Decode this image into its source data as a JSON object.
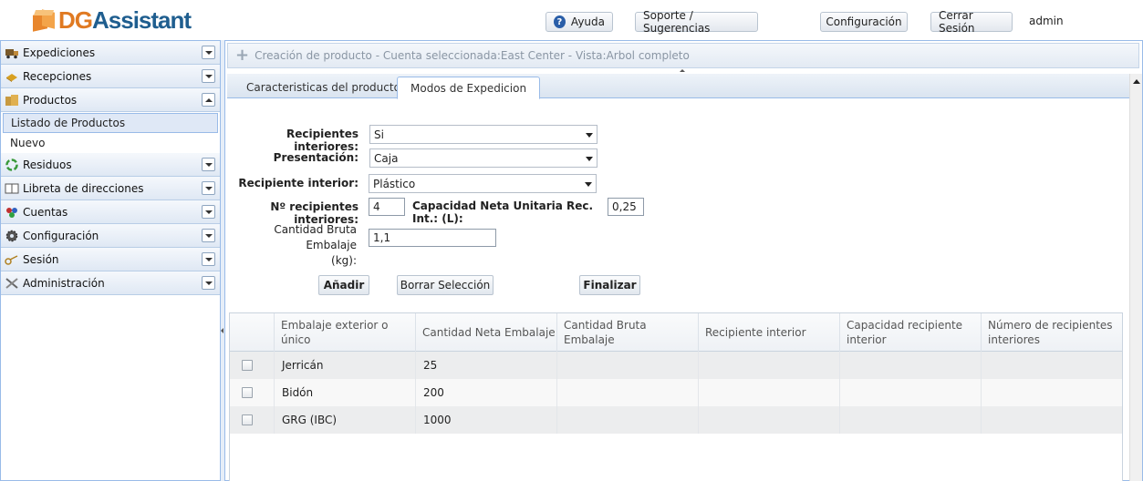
{
  "app": {
    "logo_part1": "DG",
    "logo_part2": "Assistant"
  },
  "header": {
    "help": "Ayuda",
    "support": "Soporte / Sugerencias",
    "config": "Configuración",
    "logout": "Cerrar Sesión",
    "user": "admin"
  },
  "sidebar": {
    "items": [
      {
        "label": "Expediciones",
        "icon": "truck-icon",
        "state": "collapsed"
      },
      {
        "label": "Recepciones",
        "icon": "box-icon",
        "state": "collapsed"
      },
      {
        "label": "Productos",
        "icon": "products-icon",
        "state": "expanded"
      },
      {
        "label": "Residuos",
        "icon": "recycle-icon",
        "state": "collapsed"
      },
      {
        "label": "Libreta de direcciones",
        "icon": "address-book-icon",
        "state": "collapsed"
      },
      {
        "label": "Cuentas",
        "icon": "users-icon",
        "state": "collapsed"
      },
      {
        "label": "Configuración",
        "icon": "gear-icon",
        "state": "collapsed"
      },
      {
        "label": "Sesión",
        "icon": "key-icon",
        "state": "collapsed"
      },
      {
        "label": "Administración",
        "icon": "tools-icon",
        "state": "collapsed"
      }
    ],
    "sub_items": [
      "Listado de Productos",
      "Nuevo"
    ]
  },
  "main": {
    "breadcrumb": "Creación de producto - Cuenta seleccionada:East Center - Vista:Arbol completo",
    "tabs": [
      "Caracteristicas del producto",
      "Modos de Expedicion"
    ],
    "active_tab": "Modos de Expedicion"
  },
  "form": {
    "recipientes_interiores": {
      "label": "Recipientes interiores:",
      "value": "Si"
    },
    "presentacion": {
      "label": "Presentación:",
      "value": "Caja"
    },
    "recipiente_interior": {
      "label": "Recipiente interior:",
      "value": "Plástico"
    },
    "num_recipientes": {
      "label": "Nº recipientes interiores:",
      "value": "4"
    },
    "capacidad_neta": {
      "label": "Capacidad Neta Unitaria Rec. Int.: (L):",
      "value": "0,25"
    },
    "cantidad_bruta": {
      "label_line1": "Cantidad Bruta Embalaje",
      "label_line2": "(kg):",
      "value": "1,1"
    },
    "buttons": {
      "add": "Añadir",
      "clear": "Borrar Selección",
      "finish": "Finalizar"
    }
  },
  "grid": {
    "headers": [
      "Embalaje exterior o único",
      "Cantidad Neta Embalaje",
      "Cantidad Bruta Embalaje",
      "Recipiente interior",
      "Capacidad recipiente interior",
      "Número de recipientes interiores"
    ],
    "rows": [
      {
        "embalaje": "Jerricán",
        "cantidad_neta": "25"
      },
      {
        "embalaje": "Bidón",
        "cantidad_neta": "200"
      },
      {
        "embalaje": "GRG (IBC)",
        "cantidad_neta": "1000"
      }
    ]
  }
}
